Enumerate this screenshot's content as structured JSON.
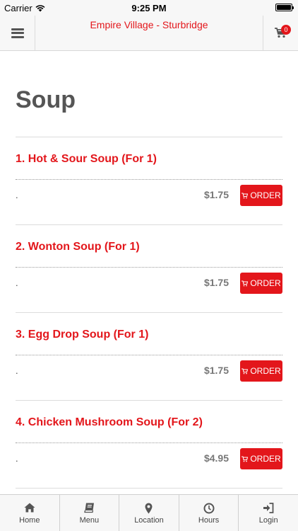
{
  "status_bar": {
    "carrier": "Carrier",
    "time": "9:25 PM"
  },
  "nav": {
    "title": "Empire Village - Sturbridge",
    "cart_count": "0"
  },
  "page": {
    "title": "Soup"
  },
  "items": [
    {
      "name": "1. Hot & Sour Soup (For 1)",
      "description": ".",
      "price": "$1.75",
      "order_label": "ORDER"
    },
    {
      "name": "2. Wonton Soup (For 1)",
      "description": ".",
      "price": "$1.75",
      "order_label": "ORDER"
    },
    {
      "name": "3. Egg Drop Soup (For 1)",
      "description": ".",
      "price": "$1.75",
      "order_label": "ORDER"
    },
    {
      "name": "4. Chicken Mushroom Soup (For 2)",
      "description": ".",
      "price": "$4.95",
      "order_label": "ORDER"
    }
  ],
  "tabs": [
    {
      "label": "Home",
      "icon": "home-icon"
    },
    {
      "label": "Menu",
      "icon": "book-icon"
    },
    {
      "label": "Location",
      "icon": "location-pin-icon"
    },
    {
      "label": "Hours",
      "icon": "clock-icon"
    },
    {
      "label": "Login",
      "icon": "login-icon"
    }
  ],
  "colors": {
    "accent": "#e3161b",
    "bar_background": "#f7f7f7"
  }
}
